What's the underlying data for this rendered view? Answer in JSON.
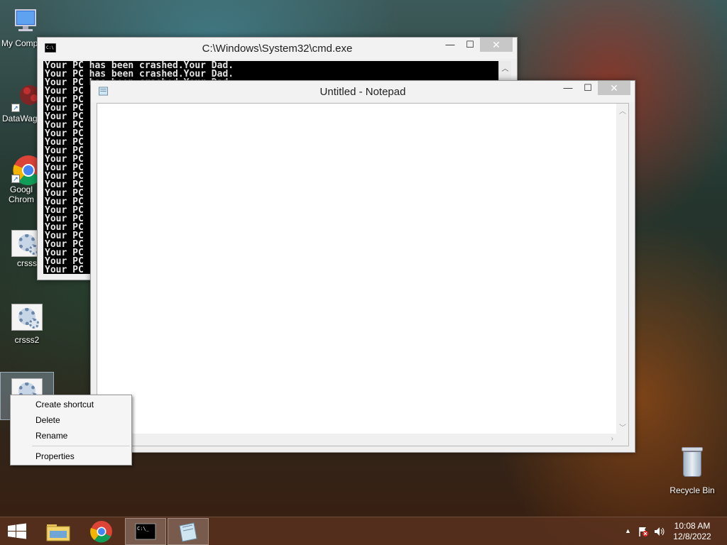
{
  "desktop_icons": [
    {
      "label": "My Comp"
    },
    {
      "label": "DataWag"
    },
    {
      "label": "Googl Chrom"
    },
    {
      "label": "crsss"
    },
    {
      "label": "crsss2"
    }
  ],
  "recycle_bin": {
    "label": "Recycle Bin"
  },
  "cmd_window": {
    "title": "C:\\Windows\\System32\\cmd.exe",
    "lines": [
      "Your PC has been crashed.Your Dad.",
      "Your PC has been crashed.Your Dad.",
      "Your PC has been crashed.Your Dad.",
      "Your PC",
      "Your PC",
      "Your PC",
      "Your PC",
      "Your PC",
      "Your PC",
      "Your PC",
      "Your PC",
      "Your PC",
      "Your PC",
      "Your PC",
      "Your PC",
      "Your PC",
      "Your PC",
      "Your PC",
      "Your PC",
      "Your PC",
      "Your PC",
      "Your PC",
      "Your PC",
      "Your PC",
      "Your PC"
    ]
  },
  "notepad_window": {
    "title": "Untitled - Notepad",
    "content": ""
  },
  "window_buttons": {
    "minimize": "—",
    "maximize": "☐",
    "close": "✕"
  },
  "context_menu": {
    "items": [
      {
        "label": "Create shortcut"
      },
      {
        "label": "Delete"
      },
      {
        "label": "Rename"
      }
    ],
    "properties": "Properties"
  },
  "taskbar": {
    "time": "10:08 AM",
    "date": "12/8/2022",
    "tray_arrow": "▲"
  },
  "colors": {
    "accent": "#1c5fb8",
    "taskbar": "#5a321e"
  }
}
